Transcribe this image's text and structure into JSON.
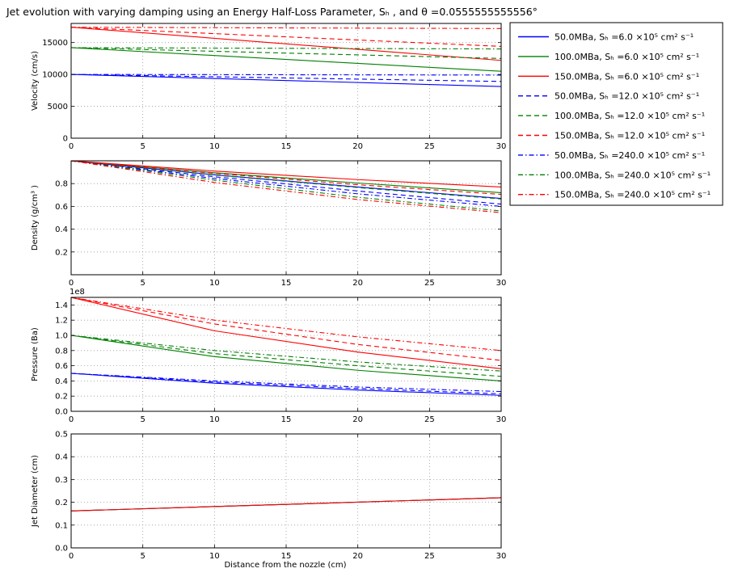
{
  "figure": {
    "title": "Jet evolution with varying damping using an Energy Half-Loss Parameter, Sₕ , and θ =0.0555555555556°",
    "xlabel": "Distance from the nozzle (cm)"
  },
  "legend": [
    {
      "label": "50.0MBa, Sₕ =6.0 ×10⁵ cm² s⁻¹",
      "color": "#0000ff",
      "style": "solid"
    },
    {
      "label": "100.0MBa, Sₕ =6.0 ×10⁵ cm² s⁻¹",
      "color": "#008000",
      "style": "solid"
    },
    {
      "label": "150.0MBa, Sₕ =6.0 ×10⁵ cm² s⁻¹",
      "color": "#ff0000",
      "style": "solid"
    },
    {
      "label": "50.0MBa, Sₕ =12.0 ×10⁵ cm² s⁻¹",
      "color": "#0000ff",
      "style": "dashed"
    },
    {
      "label": "100.0MBa, Sₕ =12.0 ×10⁵ cm² s⁻¹",
      "color": "#008000",
      "style": "dashed"
    },
    {
      "label": "150.0MBa, Sₕ =12.0 ×10⁵ cm² s⁻¹",
      "color": "#ff0000",
      "style": "dashed"
    },
    {
      "label": "50.0MBa, Sₕ =240.0 ×10⁵ cm² s⁻¹",
      "color": "#0000ff",
      "style": "dashdot"
    },
    {
      "label": "100.0MBa, Sₕ =240.0 ×10⁵ cm² s⁻¹",
      "color": "#008000",
      "style": "dashdot"
    },
    {
      "label": "150.0MBa, Sₕ =240.0 ×10⁵ cm² s⁻¹",
      "color": "#ff0000",
      "style": "dashdot"
    }
  ],
  "chart_data": [
    {
      "type": "line",
      "ylabel": "Velocity (cm/s)",
      "xlim": [
        0,
        30
      ],
      "ylim": [
        0,
        18000
      ],
      "xticks": [
        0,
        5,
        10,
        15,
        20,
        25,
        30
      ],
      "yticks": [
        0,
        5000,
        10000,
        15000
      ],
      "grid": true,
      "series": [
        {
          "x": [
            0,
            30
          ],
          "y": [
            10000,
            8100
          ],
          "color": "#0000ff",
          "style": "solid"
        },
        {
          "x": [
            0,
            30
          ],
          "y": [
            14200,
            10500
          ],
          "color": "#008000",
          "style": "solid"
        },
        {
          "x": [
            0,
            30
          ],
          "y": [
            17400,
            12200
          ],
          "color": "#ff0000",
          "style": "solid"
        },
        {
          "x": [
            0,
            30
          ],
          "y": [
            10000,
            8900
          ],
          "color": "#0000ff",
          "style": "dashed"
        },
        {
          "x": [
            0,
            30
          ],
          "y": [
            14200,
            12500
          ],
          "color": "#008000",
          "style": "dashed"
        },
        {
          "x": [
            0,
            30
          ],
          "y": [
            17400,
            14400
          ],
          "color": "#ff0000",
          "style": "dashed"
        },
        {
          "x": [
            0,
            30
          ],
          "y": [
            10000,
            9900
          ],
          "color": "#0000ff",
          "style": "dashdot"
        },
        {
          "x": [
            0,
            30
          ],
          "y": [
            14200,
            14000
          ],
          "color": "#008000",
          "style": "dashdot"
        },
        {
          "x": [
            0,
            30
          ],
          "y": [
            17400,
            17200
          ],
          "color": "#ff0000",
          "style": "dashdot"
        }
      ]
    },
    {
      "type": "line",
      "ylabel": "Density (g/cm³ )",
      "xlim": [
        0,
        30
      ],
      "ylim": [
        0.0,
        1.0
      ],
      "xticks": [
        0,
        5,
        10,
        15,
        20,
        25,
        30
      ],
      "yticks": [
        0.2,
        0.4,
        0.6,
        0.8
      ],
      "grid": true,
      "series": [
        {
          "x": [
            0,
            10,
            20,
            30
          ],
          "y": [
            1.0,
            0.877,
            0.77,
            0.67
          ],
          "color": "#0000ff",
          "style": "solid"
        },
        {
          "x": [
            0,
            10,
            20,
            30
          ],
          "y": [
            1.0,
            0.895,
            0.805,
            0.72
          ],
          "color": "#008000",
          "style": "solid"
        },
        {
          "x": [
            0,
            10,
            20,
            30
          ],
          "y": [
            1.0,
            0.91,
            0.835,
            0.77
          ],
          "color": "#ff0000",
          "style": "solid"
        },
        {
          "x": [
            0,
            10,
            20,
            30
          ],
          "y": [
            1.0,
            0.86,
            0.735,
            0.62
          ],
          "color": "#0000ff",
          "style": "dashed"
        },
        {
          "x": [
            0,
            10,
            20,
            30
          ],
          "y": [
            1.0,
            0.875,
            0.765,
            0.665
          ],
          "color": "#008000",
          "style": "dashed"
        },
        {
          "x": [
            0,
            10,
            20,
            30
          ],
          "y": [
            1.0,
            0.89,
            0.79,
            0.705
          ],
          "color": "#ff0000",
          "style": "dashed"
        },
        {
          "x": [
            0,
            10,
            20,
            30
          ],
          "y": [
            1.0,
            0.845,
            0.71,
            0.6
          ],
          "color": "#0000ff",
          "style": "dashdot"
        },
        {
          "x": [
            0,
            10,
            20,
            30
          ],
          "y": [
            1.0,
            0.83,
            0.68,
            0.56
          ],
          "color": "#008000",
          "style": "dashdot"
        },
        {
          "x": [
            0,
            10,
            20,
            30
          ],
          "y": [
            1.0,
            0.81,
            0.66,
            0.545
          ],
          "color": "#ff0000",
          "style": "dashdot"
        }
      ]
    },
    {
      "type": "line",
      "ylabel": "Pressure (Ba)",
      "scale_label": "1e8",
      "xlim": [
        0,
        30
      ],
      "ylim": [
        0.0,
        1.5
      ],
      "xticks": [
        0,
        5,
        10,
        15,
        20,
        25,
        30
      ],
      "yticks": [
        0.0,
        0.2,
        0.4,
        0.6,
        0.8,
        1.0,
        1.2,
        1.4
      ],
      "grid": true,
      "series": [
        {
          "x": [
            0,
            10,
            20,
            30
          ],
          "y": [
            0.5,
            0.37,
            0.28,
            0.21
          ],
          "color": "#0000ff",
          "style": "solid"
        },
        {
          "x": [
            0,
            10,
            20,
            30
          ],
          "y": [
            1.0,
            0.72,
            0.54,
            0.4
          ],
          "color": "#008000",
          "style": "solid"
        },
        {
          "x": [
            0,
            10,
            20,
            30
          ],
          "y": [
            1.5,
            1.06,
            0.78,
            0.56
          ],
          "color": "#ff0000",
          "style": "solid"
        },
        {
          "x": [
            0,
            10,
            20,
            30
          ],
          "y": [
            0.5,
            0.385,
            0.3,
            0.23
          ],
          "color": "#0000ff",
          "style": "dashed"
        },
        {
          "x": [
            0,
            10,
            20,
            30
          ],
          "y": [
            1.0,
            0.76,
            0.6,
            0.46
          ],
          "color": "#008000",
          "style": "dashed"
        },
        {
          "x": [
            0,
            10,
            20,
            30
          ],
          "y": [
            1.5,
            1.15,
            0.88,
            0.67
          ],
          "color": "#ff0000",
          "style": "dashed"
        },
        {
          "x": [
            0,
            10,
            20,
            30
          ],
          "y": [
            0.5,
            0.4,
            0.32,
            0.26
          ],
          "color": "#0000ff",
          "style": "dashdot"
        },
        {
          "x": [
            0,
            10,
            20,
            30
          ],
          "y": [
            1.0,
            0.8,
            0.65,
            0.53
          ],
          "color": "#008000",
          "style": "dashdot"
        },
        {
          "x": [
            0,
            10,
            20,
            30
          ],
          "y": [
            1.5,
            1.2,
            0.98,
            0.8
          ],
          "color": "#ff0000",
          "style": "dashdot"
        }
      ]
    },
    {
      "type": "line",
      "ylabel": "Jet Diameter (cm)",
      "xlim": [
        0,
        30
      ],
      "ylim": [
        0.0,
        0.5
      ],
      "xticks": [
        0,
        5,
        10,
        15,
        20,
        25,
        30
      ],
      "yticks": [
        0.0,
        0.1,
        0.2,
        0.3,
        0.4,
        0.5
      ],
      "grid": true,
      "series": [
        {
          "x": [
            0,
            30
          ],
          "y": [
            0.162,
            0.22
          ],
          "color": "#0000ff",
          "style": "solid"
        },
        {
          "x": [
            0,
            30
          ],
          "y": [
            0.162,
            0.22
          ],
          "color": "#008000",
          "style": "solid"
        },
        {
          "x": [
            0,
            30
          ],
          "y": [
            0.162,
            0.22
          ],
          "color": "#ff0000",
          "style": "solid"
        }
      ]
    }
  ]
}
